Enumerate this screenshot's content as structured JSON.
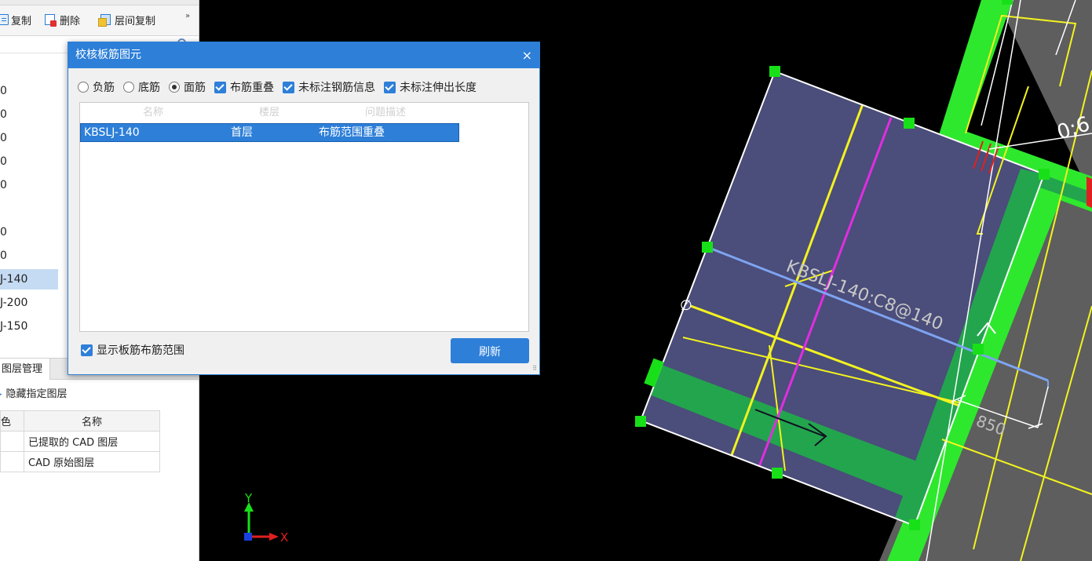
{
  "toolbar": {
    "copy_label": "复制",
    "delete_label": "删除",
    "floor_copy_label": "层间复制",
    "more": "»"
  },
  "list": {
    "items": [
      "0",
      "0",
      "0",
      "0",
      "0",
      "0",
      "0",
      "J-140",
      "J-200",
      "J-150"
    ],
    "selected_index": 7
  },
  "layer_panel": {
    "tab_label": "图层管理",
    "hide_label": "隐藏指定图层",
    "columns": [
      "色",
      "名称"
    ],
    "rows": [
      {
        "name": "已提取的 CAD 图层"
      },
      {
        "name": "CAD 原始图层"
      }
    ]
  },
  "dialog": {
    "title": "校核板筋图元",
    "close": "×",
    "options": {
      "negative_rebar": "负筋",
      "bottom_rebar": "底筋",
      "top_rebar": "面筋",
      "overlap": "布筋重叠",
      "unlabeled_info": "未标注钢筋信息",
      "unlabeled_length": "未标注伸出长度"
    },
    "selected_radio": "top_rebar",
    "grid": {
      "columns": [
        "名称",
        "楼层",
        "问题描述"
      ],
      "rows": [
        {
          "name": "KBSLJ-140",
          "floor": "首层",
          "problem": "布筋范围重叠"
        }
      ]
    },
    "show_range_label": "显示板筋布筋范围",
    "refresh_label": "刷新"
  },
  "canvas": {
    "rebar_label": "KBSLJ-140:C8@140",
    "dim_850": "850",
    "partial_label": "0;6",
    "axis_x": "X",
    "axis_y": "Y",
    "colors": {
      "slab_fill": "#4b4d7a",
      "green_band": "#23a54e",
      "bright_green": "#2ee82e",
      "yellow_line": "#f3f31f",
      "magenta_line": "#e02ee0",
      "blue_line": "#7ea4f2",
      "grey_fill": "#5e5e5e"
    }
  }
}
